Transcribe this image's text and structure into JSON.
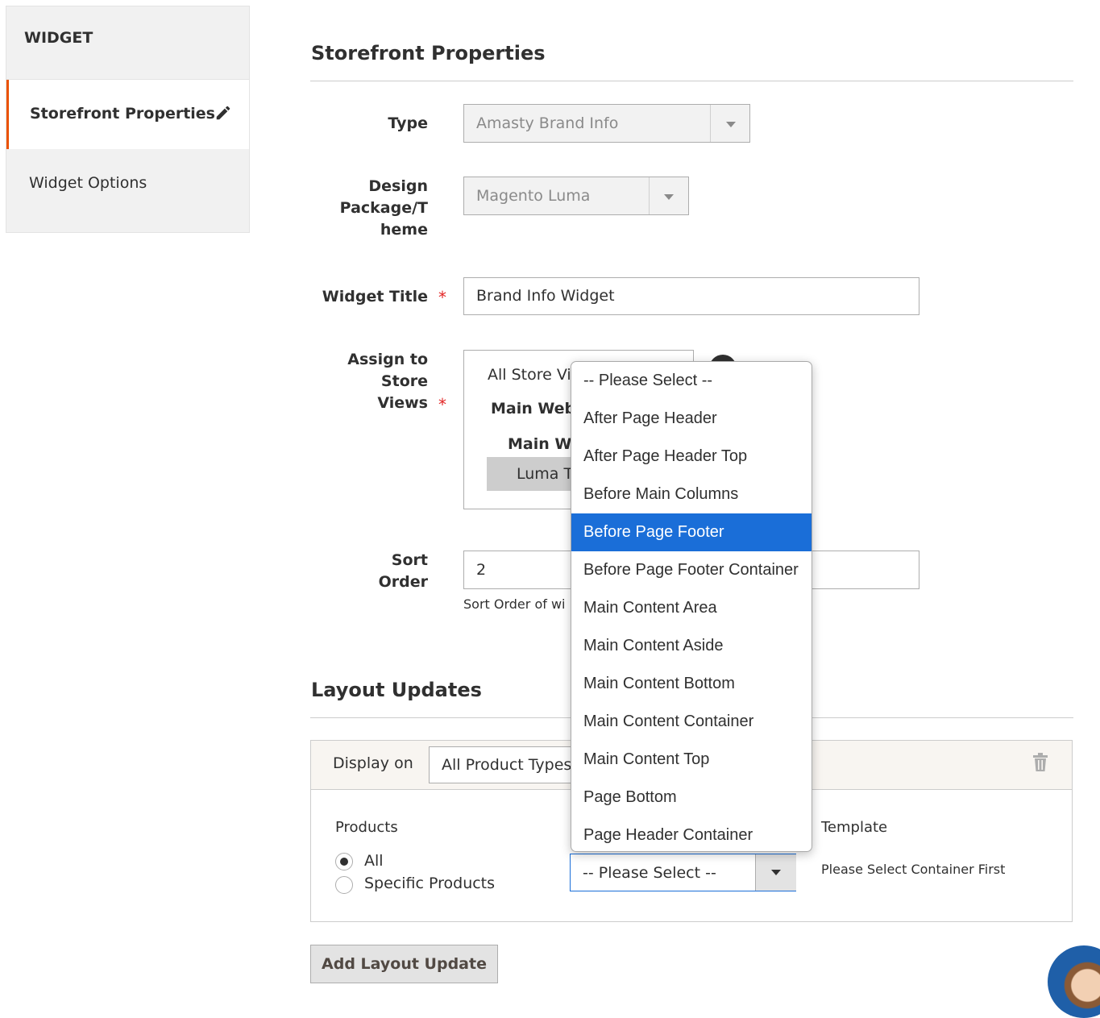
{
  "sidebar": {
    "header": "WIDGET",
    "items": [
      {
        "label": "Storefront Properties",
        "active": true
      },
      {
        "label": "Widget Options",
        "active": false
      }
    ]
  },
  "storefront": {
    "title": "Storefront Properties",
    "type_label": "Type",
    "type_value": "Amasty Brand Info",
    "design_label_lines": [
      "Design",
      "Package/T",
      "heme"
    ],
    "design_value": "Magento Luma",
    "title_label": "Widget Title",
    "title_value": "Brand Info Widget",
    "assign_label_lines": [
      "Assign to",
      "Store",
      "Views"
    ],
    "store_views": {
      "all": "All Store Vi",
      "website": "Main Web",
      "store": "Main W",
      "view": "Luma T"
    },
    "sort_label_lines": [
      "Sort",
      "Order"
    ],
    "sort_value": "2",
    "sort_note": "Sort Order of wi",
    "required_mark": "*"
  },
  "layout": {
    "title": "Layout Updates",
    "display_on_label": "Display on",
    "display_on_value": "All Product Types",
    "products_label": "Products",
    "radio_all": "All",
    "radio_specific": "Specific Products",
    "container_select_value": "-- Please Select --",
    "template_label": "Template",
    "template_note": "Please Select Container First",
    "add_button": "Add Layout Update"
  },
  "dropdown": {
    "selected_index": 4,
    "options": [
      "-- Please Select --",
      "After Page Header",
      "After Page Header Top",
      "Before Main Columns",
      "Before Page Footer",
      "Before Page Footer Container",
      "Main Content Area",
      "Main Content Aside",
      "Main Content Bottom",
      "Main Content Container",
      "Main Content Top",
      "Page Bottom",
      "Page Header Container"
    ]
  },
  "colors": {
    "accent": "#eb5202",
    "selection": "#1a6ed8",
    "required": "#e22626"
  }
}
